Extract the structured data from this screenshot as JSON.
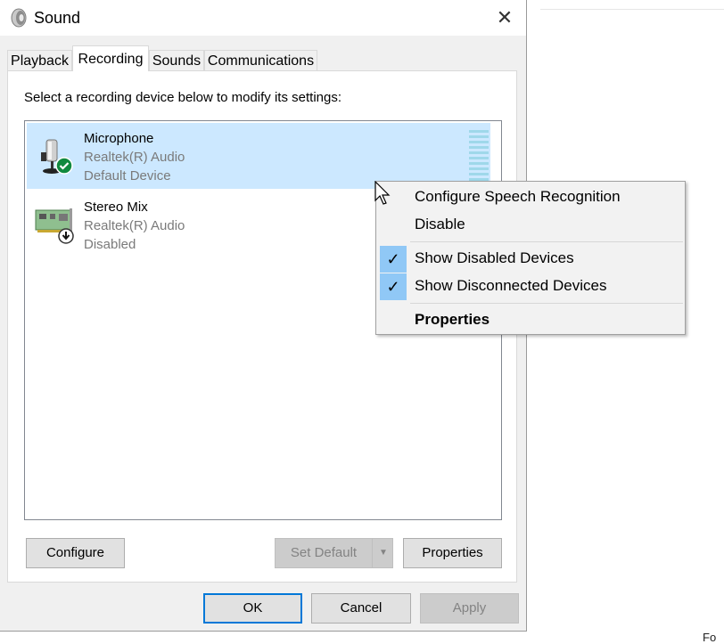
{
  "window": {
    "title": "Sound",
    "close_glyph": "✕"
  },
  "tabs": [
    {
      "label": "Playback",
      "active": false
    },
    {
      "label": "Recording",
      "active": true
    },
    {
      "label": "Sounds",
      "active": false
    },
    {
      "label": "Communications",
      "active": false
    }
  ],
  "instruction": "Select a recording device below to modify its settings:",
  "devices": [
    {
      "name": "Microphone",
      "driver": "Realtek(R) Audio",
      "status": "Default Device",
      "icon": "microphone-icon",
      "badge": "default-check-badge"
    },
    {
      "name": "Stereo Mix",
      "driver": "Realtek(R) Audio",
      "status": "Disabled",
      "icon": "sound-card-icon",
      "badge": "disabled-arrow-badge"
    }
  ],
  "buttons": {
    "configure": "Configure",
    "set_default": "Set Default",
    "properties": "Properties",
    "ok": "OK",
    "cancel": "Cancel",
    "apply": "Apply"
  },
  "context_menu": {
    "items": [
      {
        "label": "Configure Speech Recognition",
        "checked": false
      },
      {
        "label": "Disable",
        "checked": false
      },
      {
        "label": "Show Disabled Devices",
        "checked": true
      },
      {
        "label": "Show Disconnected Devices",
        "checked": true
      },
      {
        "label": "Properties",
        "checked": false,
        "bold": true
      }
    ],
    "check_glyph": "✓"
  },
  "background": {
    "corner_text": "Fo"
  },
  "colors": {
    "selection": "#cce8ff",
    "accent": "#0078d7",
    "check_highlight": "#90c8f6",
    "level_meter": "#9fd8ea",
    "default_badge": "#10893e"
  }
}
